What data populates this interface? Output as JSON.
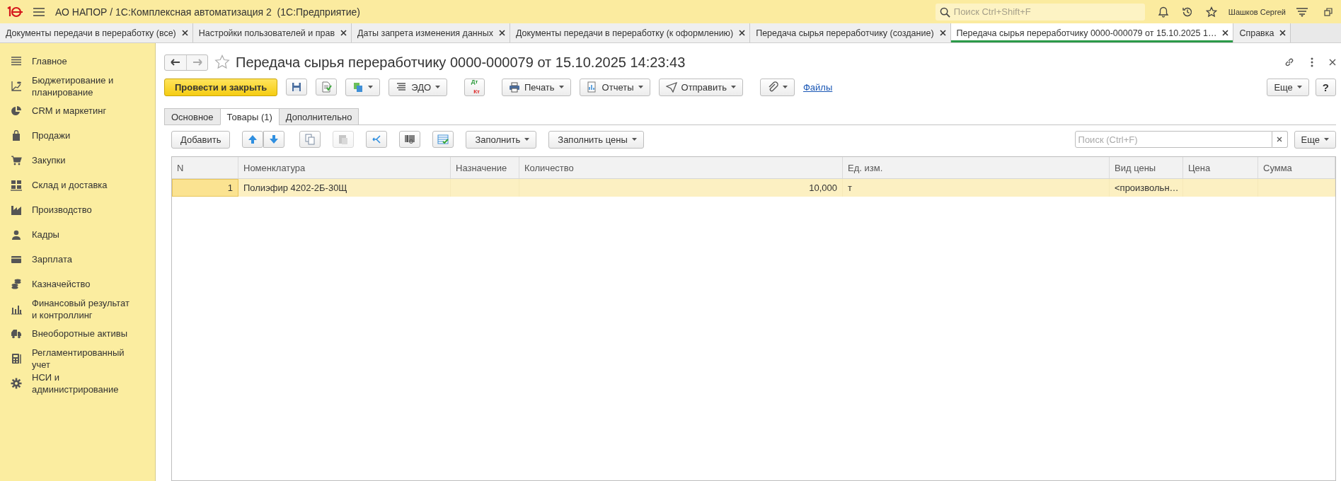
{
  "app": {
    "title": "АО НАПОР / 1С:Комплексная автоматизация 2  (1С:Предприятие)",
    "search_placeholder": "Поиск Ctrl+Shift+F",
    "user": "Шашков Сергей"
  },
  "open_tabs": [
    {
      "label": "Документы передачи в переработку (все)",
      "selected": false
    },
    {
      "label": "Настройки пользователей и прав",
      "selected": false
    },
    {
      "label": "Даты запрета изменения данных",
      "selected": false
    },
    {
      "label": "Документы передачи в переработку (к оформлению)",
      "selected": false
    },
    {
      "label": "Передача сырья переработчику (создание)",
      "selected": false
    },
    {
      "label": "Передача сырья переработчику 0000-000079 от 15.10.2025 1…",
      "selected": true
    },
    {
      "label": "Справка",
      "selected": false
    }
  ],
  "sidebar": {
    "items": [
      {
        "label": "Главное"
      },
      {
        "label": "Бюджетирование и планирование"
      },
      {
        "label": "CRM и маркетинг"
      },
      {
        "label": "Продажи"
      },
      {
        "label": "Закупки"
      },
      {
        "label": "Склад и доставка"
      },
      {
        "label": "Производство"
      },
      {
        "label": "Кадры"
      },
      {
        "label": "Зарплата"
      },
      {
        "label": "Казначейство"
      },
      {
        "label": "Финансовый результат и контроллинг"
      },
      {
        "label": "Внеоборотные активы"
      },
      {
        "label": "Регламентированный учет"
      },
      {
        "label": "НСИ и администрирование"
      }
    ]
  },
  "document": {
    "title": "Передача сырья переработчику 0000-000079 от 15.10.2025 14:23:43",
    "favorite": false,
    "toolbar": [
      {
        "kind": "primary",
        "label": "Провести и закрыть"
      },
      {
        "kind": "icon"
      },
      {
        "kind": "icon"
      },
      {
        "kind": "icon-menu"
      },
      {
        "kind": "menu",
        "label": "ЭДО"
      },
      {
        "kind": "dtkt",
        "top": "Дт",
        "bottom": "Кт"
      },
      {
        "kind": "menu",
        "label": "Печать"
      },
      {
        "kind": "menu",
        "label": "Отчеты"
      },
      {
        "kind": "menu",
        "label": "Отправить"
      },
      {
        "kind": "icon-menu"
      },
      {
        "kind": "link",
        "label": "Файлы"
      }
    ],
    "more_button": "Еще",
    "help_button": "?",
    "form_tabs": [
      {
        "label": "Основное",
        "selected": false
      },
      {
        "label": "Товары (1)",
        "selected": true
      },
      {
        "label": "Дополнительно",
        "selected": false
      }
    ],
    "table_toolbar": [
      {
        "kind": "text",
        "label": "Добавить",
        "disabled": false
      },
      {
        "kind": "icon",
        "disabled": false
      },
      {
        "kind": "icon-joined",
        "disabled": false
      },
      {
        "kind": "icon",
        "disabled": false
      },
      {
        "kind": "icon",
        "disabled": true
      },
      {
        "kind": "icon",
        "disabled": false
      },
      {
        "kind": "icon",
        "disabled": false
      },
      {
        "kind": "icon",
        "disabled": false
      },
      {
        "kind": "menu",
        "label": "Заполнить",
        "disabled": false
      },
      {
        "kind": "menu",
        "label": "Заполнить цены",
        "disabled": false
      }
    ],
    "search": {
      "placeholder": "Поиск (Ctrl+F)"
    },
    "table_more_button": "Еще",
    "table": {
      "columns": [
        "N",
        "Номенклатура",
        "Назначение",
        "Количество",
        "Ед. изм.",
        "Вид цены",
        "Цена",
        "Сумма"
      ],
      "rows": [
        {
          "selected": true,
          "n": "1",
          "nomenclature": "Полиэфир 4202-2Б-30Щ",
          "quantity": "10,000",
          "unit": "т",
          "price_type": "<произвольн…"
        }
      ]
    }
  }
}
